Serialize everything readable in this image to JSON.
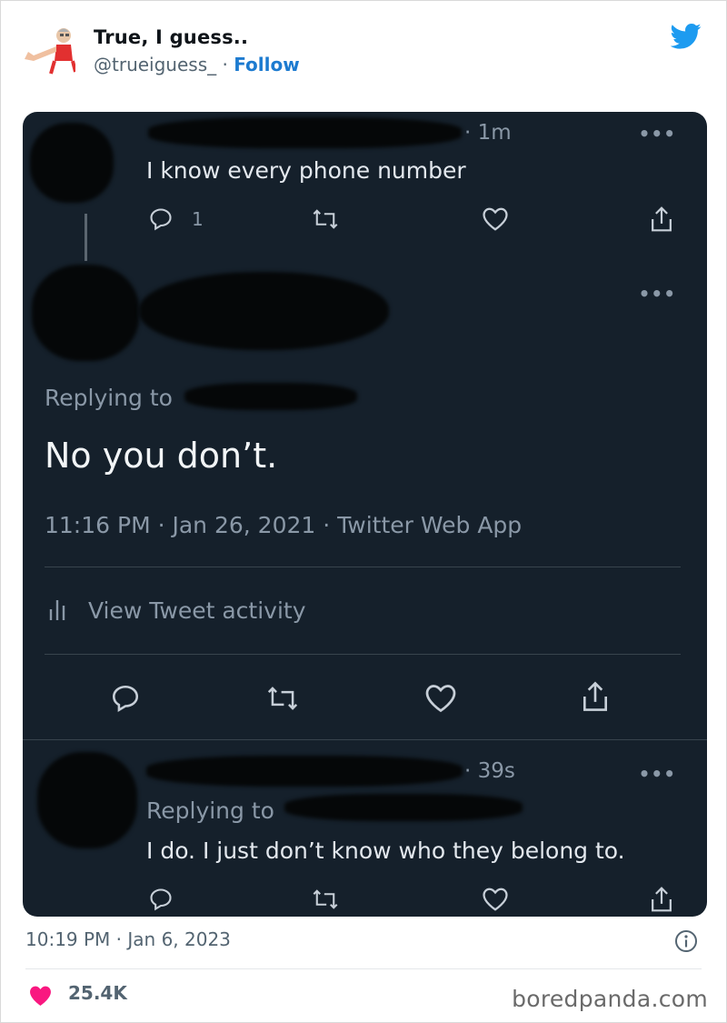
{
  "author": {
    "display_name": "True, I guess..",
    "handle": "@trueiguess_",
    "separator": " · ",
    "follow_label": "Follow"
  },
  "screenshot": {
    "first_tweet": {
      "time": "· 1m",
      "text": "I know every phone number",
      "reply_count": "1"
    },
    "main_tweet": {
      "replying_to_label": "Replying to",
      "text": "No you don’t.",
      "meta": "11:16 PM · Jan 26, 2021 · Twitter Web App",
      "activity_label": "View Tweet activity"
    },
    "reply_tweet": {
      "time": "· 39s",
      "replying_to_label": "Replying to",
      "text": "I do. I just don’t know who they belong to."
    },
    "more_label": "•••"
  },
  "footer": {
    "timestamp": "10:19 PM · Jan 6, 2023",
    "likes": "25.4K",
    "brand": "boredpanda.com"
  },
  "colors": {
    "screenshot_bg": "#15202b",
    "follow": "#1d7bd0",
    "twitter_blue": "#1d9bf0",
    "like_red": "#f91880"
  },
  "icons": [
    "twitter-bird-icon",
    "reply-icon",
    "retweet-icon",
    "like-icon",
    "share-icon",
    "bar-chart-icon",
    "info-icon",
    "heart-icon"
  ]
}
